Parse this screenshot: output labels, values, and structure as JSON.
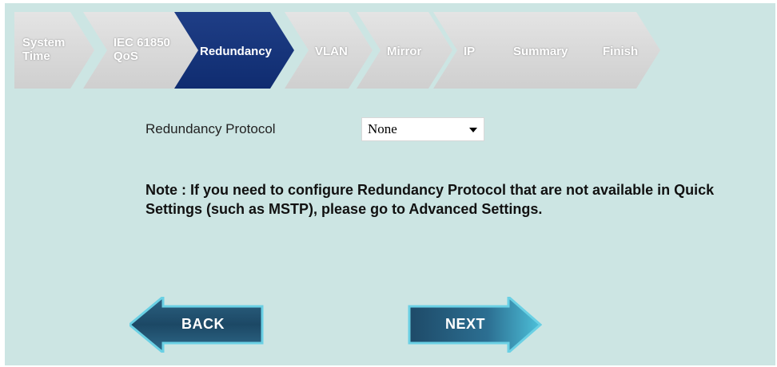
{
  "wizard": {
    "steps": [
      {
        "label_line1": "System",
        "label_line2": "Time",
        "active": false
      },
      {
        "label_line1": "IEC 61850",
        "label_line2": "QoS",
        "active": false
      },
      {
        "label_line1": "Redundancy",
        "label_line2": "",
        "active": true
      },
      {
        "label_line1": "VLAN",
        "label_line2": "",
        "active": false
      },
      {
        "label_line1": "Mirror",
        "label_line2": "",
        "active": false
      },
      {
        "label_line1": "IP",
        "label_line2": "",
        "active": false
      },
      {
        "label_line1": "Summary",
        "label_line2": "",
        "active": false
      },
      {
        "label_line1": "Finish",
        "label_line2": "",
        "active": false
      }
    ]
  },
  "form": {
    "redundancy_label": "Redundancy Protocol",
    "redundancy_value": "None"
  },
  "note": {
    "text": "Note : If you need to configure Redundancy Protocol that are not available in Quick Settings (such as MSTP), please go to Advanced Settings."
  },
  "navigation": {
    "back_label": "BACK",
    "next_label": "NEXT"
  },
  "colors": {
    "background": "#cce5e3",
    "active_step": "#1a3a80",
    "button_dark": "#1f4d6e",
    "button_light": "#5fc3d8"
  }
}
